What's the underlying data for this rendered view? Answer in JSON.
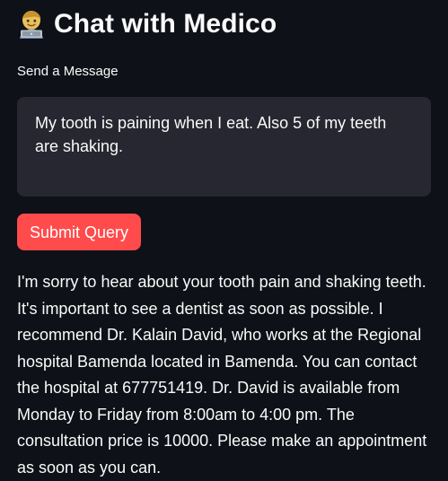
{
  "header": {
    "icon": "technologist-emoji-icon",
    "title": "Chat with Medico"
  },
  "message_input": {
    "label": "Send a Message",
    "value": "My tooth is paining when I eat. Also 5 of my teeth are shaking."
  },
  "submit_button": {
    "label": "Submit Query"
  },
  "response": {
    "text": "I'm sorry to hear about your tooth pain and shaking teeth. It's important to see a dentist as soon as possible. I recommend Dr. Kalain David, who works at the Regional hospital Bamenda located in Bamenda. You can contact the hospital at 677751419. Dr. David is available from Monday to Friday from 8:00am to 4:00 pm. The consultation price is 10000. Please make an appointment as soon as you can."
  },
  "colors": {
    "background": "#0e1117",
    "input_background": "#262730",
    "accent": "#ff4b4b",
    "text": "#fafafa"
  }
}
